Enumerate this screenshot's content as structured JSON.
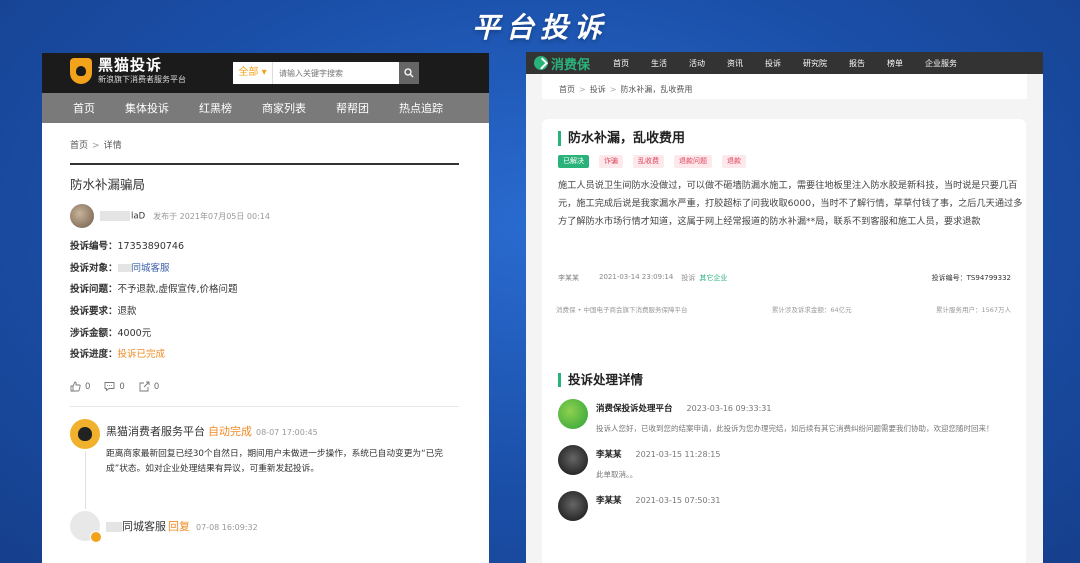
{
  "page_title": "平台投诉",
  "left": {
    "logo": {
      "main": "黑猫投诉",
      "sub": "新浪旗下消费者服务平台"
    },
    "search": {
      "scope": "全部",
      "placeholder": "请输入关键字搜索"
    },
    "nav": [
      "首页",
      "集体投诉",
      "红黑榜",
      "商家列表",
      "帮帮团",
      "热点追踪"
    ],
    "breadcrumb": {
      "home": "首页",
      "sep": ">",
      "current": "详情"
    },
    "complaint_title": "防水补漏骗局",
    "author": {
      "name": "laD",
      "meta": "发布于 2021年07月05日 00:14"
    },
    "fields": [
      {
        "label": "投诉编号：",
        "value": "17353890746"
      },
      {
        "label": "投诉对象：",
        "value": "同城客服"
      },
      {
        "label": "投诉问题：",
        "value": "不予退款,虚假宣传,价格问题"
      },
      {
        "label": "投诉要求：",
        "value": "退款"
      },
      {
        "label": "涉诉金额：",
        "value": "4000元"
      },
      {
        "label": "投诉进度：",
        "value": "投诉已完成"
      }
    ],
    "actions": {
      "like": "0",
      "comment": "0",
      "share": "0"
    },
    "reply1": {
      "name": "黑猫消费者服务平台",
      "status": "自动完成",
      "time": "08-07 17:00:45",
      "text": "距离商家最新回复已经30个自然日，期间用户未做进一步操作，系统已自动变更为“已完成”状态。如对企业处理结果有异议，可重新发起投诉。"
    },
    "reply2": {
      "name": "同城客服",
      "status": "回复",
      "time": "07-08 16:09:32"
    }
  },
  "right": {
    "logo": "消费保",
    "nav": [
      "首页",
      "生活",
      "活动",
      "资讯",
      "投诉",
      "研究院",
      "报告",
      "榜单",
      "企业服务"
    ],
    "breadcrumb": [
      "首页",
      "投诉",
      "防水补漏，乱收费用"
    ],
    "title": "防水补漏，乱收费用",
    "tags": [
      "已解决",
      "诈骗",
      "乱收费",
      "退款问题",
      "退款"
    ],
    "description": "施工人员说卫生间防水没做过，可以做不砸墙防漏水施工，需要往地板里注入防水胶是新科技，当时说是只要几百元，施工完成后说是我家漏水严重，打胶超标了问我收取6000，当时不了解行情，草草付钱了事，之后几天通过多方了解防水市场行情才知道，这属于网上经常报道的防水补漏**局，联系不到客服和施工人员，要求退款",
    "meta": {
      "user": "李某某",
      "time": "2021-03-14 23:09:14",
      "action": "投诉",
      "target": "其它企业",
      "number": "投诉编号：TS94799332"
    },
    "footer": {
      "left": "消费保 • 中国电子商会旗下消费服务保障平台",
      "mid": "累计涉及诉求金额：64亿元",
      "right": "累计服务用户：1567万人"
    },
    "details_title": "投诉处理详情",
    "entries": [
      {
        "name": "消费保投诉处理平台",
        "time": "2023-03-16 09:33:31",
        "text": "投诉人您好，已收到您的结案申请，此投诉为您办理完结，如后续有其它消费纠纷问题需要我们协助，欢迎您随时回来！"
      },
      {
        "name": "李某某",
        "time": "2021-03-15 11:28:15",
        "text": "此单取消。。"
      },
      {
        "name": "李某某",
        "time": "2021-03-15 07:50:31",
        "text": ""
      }
    ]
  }
}
